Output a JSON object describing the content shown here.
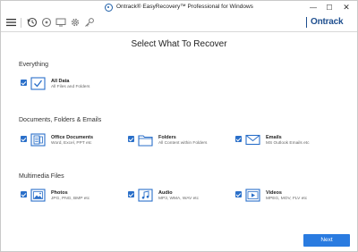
{
  "window": {
    "title": "Ontrack® EasyRecovery™ Professional for Windows",
    "minimize": "—",
    "maximize": "☐",
    "close": "✕"
  },
  "toolbar": {
    "icons": [
      "menu-icon",
      "recover-icon",
      "drive-icon",
      "settings-icon",
      "key-icon"
    ],
    "brand": "Ontrack"
  },
  "heading": "Select What To Recover",
  "sections": {
    "everything": {
      "title": "Everything",
      "options": [
        {
          "label": "All Data",
          "sub": "All Files and Folders",
          "icon": "check-box-icon",
          "checked": true
        }
      ]
    },
    "documents": {
      "title": "Documents, Folders & Emails",
      "options": [
        {
          "label": "Office Documents",
          "sub": "Word, Excel, PPT etc",
          "icon": "document-icon",
          "checked": true
        },
        {
          "label": "Folders",
          "sub": "All Content within Folders",
          "icon": "folder-icon",
          "checked": true
        },
        {
          "label": "Emails",
          "sub": "MS Outlook Emails etc",
          "icon": "email-icon",
          "checked": true
        }
      ]
    },
    "multimedia": {
      "title": "Multimedia Files",
      "options": [
        {
          "label": "Photos",
          "sub": "JPG, PNG, BMP etc",
          "icon": "photo-icon",
          "checked": true
        },
        {
          "label": "Audio",
          "sub": "MP3, WMA, WAV etc",
          "icon": "audio-icon",
          "checked": true
        },
        {
          "label": "Videos",
          "sub": "MPEG, MOV, FLV etc",
          "icon": "video-icon",
          "checked": true
        }
      ]
    }
  },
  "next_label": "Next",
  "colors": {
    "accent": "#2a7be0",
    "icon": "#2a6fc9",
    "brand": "#1f4f8f"
  }
}
